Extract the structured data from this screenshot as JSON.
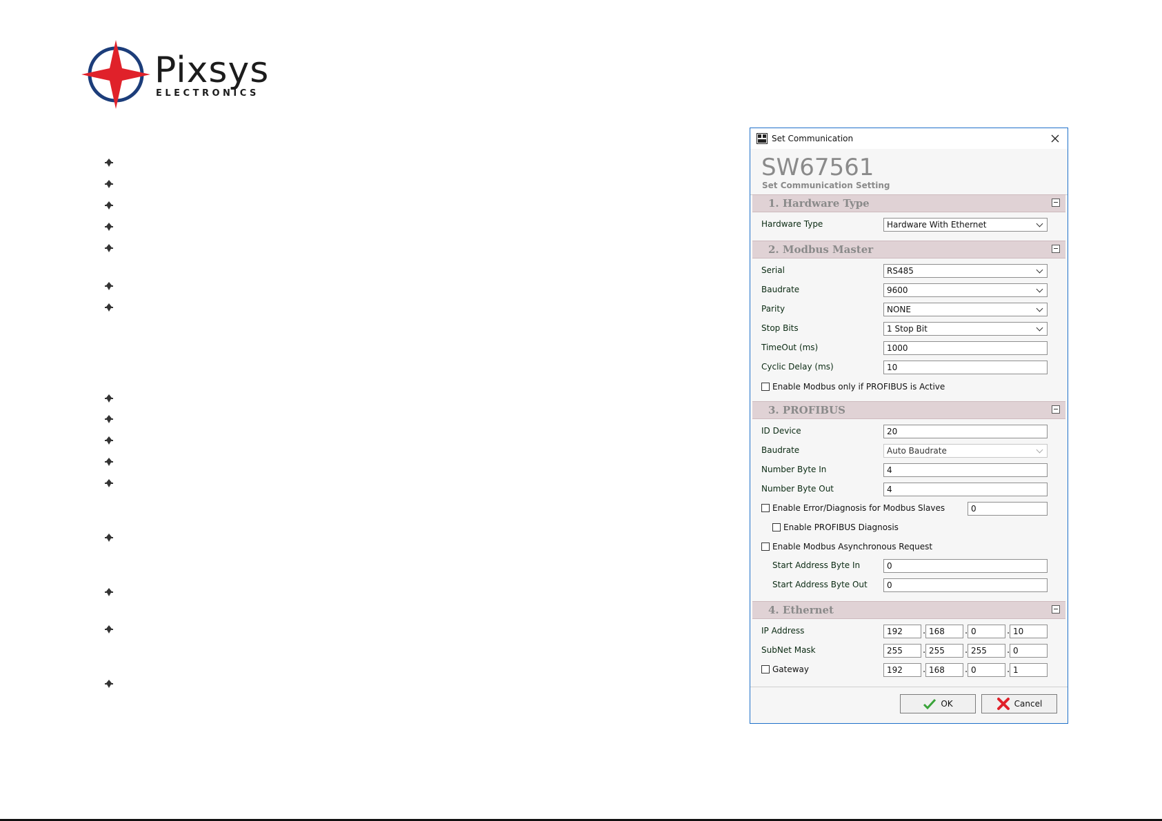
{
  "logo": {
    "brand": "Pixsys",
    "sub": "ELECTRONICS"
  },
  "colors": {
    "logo_red": "#e0212a",
    "logo_navy": "#1c3d7a",
    "section_bg": "#e0d2d5",
    "window_border": "#1e70c9"
  },
  "window": {
    "title": "Set Communication",
    "product": "SW67561",
    "subtitle": "Set Communication Setting",
    "sections": {
      "hardware": {
        "title": "1. Hardware Type"
      },
      "modbus": {
        "title": "2. Modbus Master"
      },
      "profibus": {
        "title": "3. PROFIBUS"
      },
      "ethernet": {
        "title": "4. Ethernet"
      }
    },
    "hardware_type": {
      "label": "Hardware Type",
      "value": "Hardware With Ethernet"
    },
    "modbus": {
      "serial": {
        "label": "Serial",
        "value": "RS485"
      },
      "baudrate": {
        "label": "Baudrate",
        "value": "9600"
      },
      "parity": {
        "label": "Parity",
        "value": "NONE"
      },
      "stop_bits": {
        "label": "Stop Bits",
        "value": "1 Stop Bit"
      },
      "timeout": {
        "label": "TimeOut (ms)",
        "value": "1000"
      },
      "cyclic_delay": {
        "label": "Cyclic Delay (ms)",
        "value": "10"
      },
      "enable_only_if_active": {
        "label": "Enable Modbus only if PROFIBUS is Active"
      }
    },
    "profibus": {
      "id_device": {
        "label": "ID Device",
        "value": "20"
      },
      "baudrate": {
        "label": "Baudrate",
        "value": "Auto Baudrate"
      },
      "num_byte_in": {
        "label": "Number Byte In",
        "value": "4"
      },
      "num_byte_out": {
        "label": "Number Byte Out",
        "value": "4"
      },
      "enable_error_diag": {
        "label": "Enable Error/Diagnosis for Modbus Slaves",
        "value": "0"
      },
      "enable_profibus_diag": {
        "label": "Enable PROFIBUS Diagnosis"
      },
      "enable_async": {
        "label": "Enable Modbus Asynchronous Request"
      },
      "start_addr_in": {
        "label": "Start Address Byte In",
        "value": "0"
      },
      "start_addr_out": {
        "label": "Start Address Byte Out",
        "value": "0"
      }
    },
    "ethernet": {
      "ip": {
        "label": "IP Address",
        "octets": [
          "192",
          "168",
          "0",
          "10"
        ]
      },
      "subnet": {
        "label": "SubNet Mask",
        "octets": [
          "255",
          "255",
          "255",
          "0"
        ]
      },
      "gateway": {
        "label": "Gateway",
        "octets": [
          "192",
          "168",
          "0",
          "1"
        ]
      }
    },
    "buttons": {
      "ok": "OK",
      "cancel": "Cancel"
    }
  }
}
